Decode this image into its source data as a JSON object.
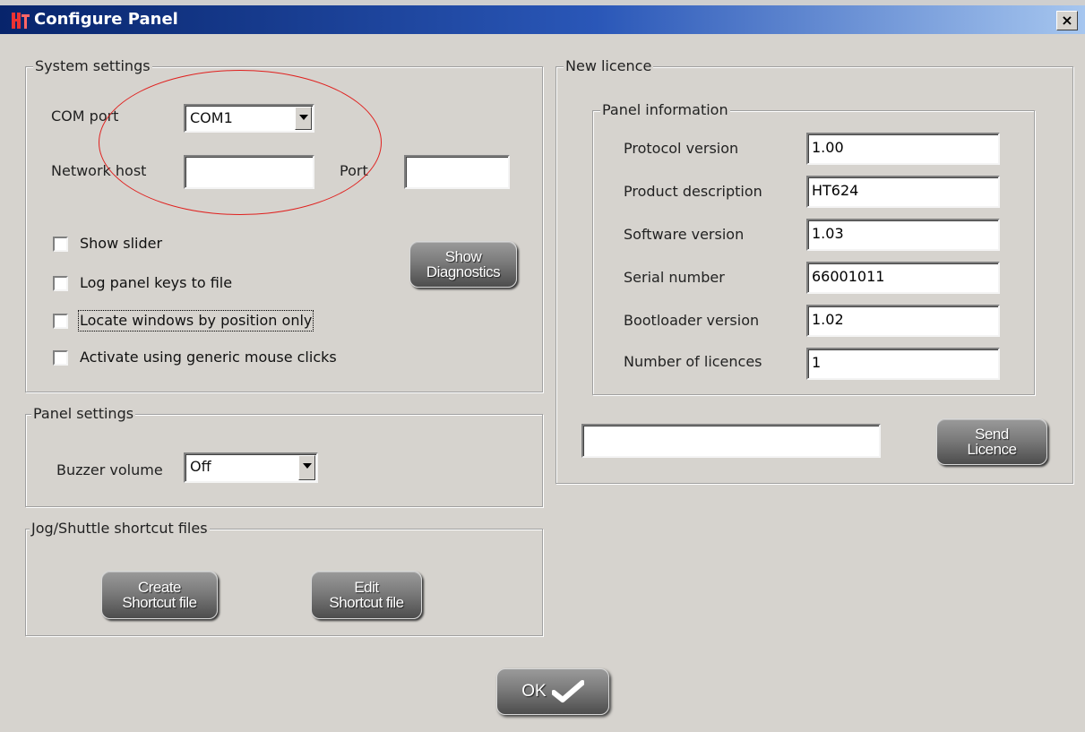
{
  "window": {
    "title": "Configure Panel",
    "close_glyph": "×",
    "icon": "app-icon"
  },
  "system_settings": {
    "legend": "System settings",
    "com_port_label": "COM port",
    "com_port_value": "COM1",
    "network_host_label": "Network host",
    "network_host_value": "",
    "port_label": "Port",
    "port_value": "",
    "checkboxes": [
      {
        "label": "Show slider",
        "checked": false
      },
      {
        "label": "Log panel keys to file",
        "checked": false
      },
      {
        "label": "Locate windows by position only",
        "checked": false
      },
      {
        "label": "Activate using generic mouse clicks",
        "checked": false
      }
    ],
    "diagnostics_button": {
      "line1": "Show",
      "line2": "Diagnostics"
    }
  },
  "panel_settings": {
    "legend": "Panel settings",
    "buzzer_label": "Buzzer volume",
    "buzzer_value": "Off"
  },
  "shortcut_files": {
    "legend": "Jog/Shuttle shortcut files",
    "create_button": {
      "line1": "Create",
      "line2": "Shortcut file"
    },
    "edit_button": {
      "line1": "Edit",
      "line2": "Shortcut file"
    }
  },
  "new_licence": {
    "legend": "New licence",
    "panel_info": {
      "legend": "Panel information",
      "rows": [
        {
          "label": "Protocol version",
          "value": "1.00"
        },
        {
          "label": "Product description",
          "value": "HT624"
        },
        {
          "label": "Software version",
          "value": "1.03"
        },
        {
          "label": "Serial number",
          "value": "66001011"
        },
        {
          "label": "Bootloader version",
          "value": "1.02"
        },
        {
          "label": "Number of licences",
          "value": "1"
        }
      ]
    },
    "licence_input_value": "",
    "send_button": {
      "line1": "Send",
      "line2": "Licence"
    }
  },
  "ok_button": {
    "label": "OK",
    "icon": "checkmark-icon"
  },
  "colors": {
    "dialog_bg": "#d6d3ce",
    "titlebar_start": "#07246b",
    "titlebar_end": "#a6c6ef",
    "annotation": "#e0201e"
  }
}
